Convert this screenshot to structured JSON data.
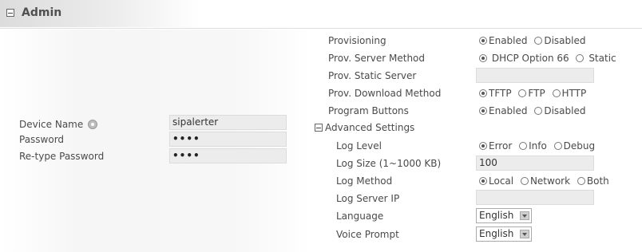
{
  "section": {
    "title": "Admin"
  },
  "left": {
    "device_name_label": "Device Name",
    "device_name_value": "sipalerter",
    "password_label": "Password",
    "password_value": "••••",
    "retype_label": "Re-type Password",
    "retype_value": "••••"
  },
  "right": {
    "provisioning": {
      "label": "Provisioning",
      "options": [
        "Enabled",
        "Disabled"
      ],
      "selected": "Enabled"
    },
    "prov_server_method": {
      "label": "Prov. Server Method",
      "options": [
        "DHCP Option 66",
        "Static"
      ],
      "selected": "DHCP Option 66"
    },
    "prov_static_server": {
      "label": "Prov. Static Server",
      "value": ""
    },
    "prov_download_method": {
      "label": "Prov. Download Method",
      "options": [
        "TFTP",
        "FTP",
        "HTTP"
      ],
      "selected": "TFTP"
    },
    "program_buttons": {
      "label": "Program Buttons",
      "options": [
        "Enabled",
        "Disabled"
      ],
      "selected": "Enabled"
    },
    "advanced_settings": {
      "label": "Advanced Settings"
    },
    "log_level": {
      "label": "Log Level",
      "options": [
        "Error",
        "Info",
        "Debug"
      ],
      "selected": "Error"
    },
    "log_size": {
      "label": "Log Size (1~1000 KB)",
      "value": "100"
    },
    "log_method": {
      "label": "Log Method",
      "options": [
        "Local",
        "Network",
        "Both"
      ],
      "selected": "Local"
    },
    "log_server_ip": {
      "label": "Log Server IP",
      "value": ""
    },
    "language": {
      "label": "Language",
      "value": "English"
    },
    "voice_prompt": {
      "label": "Voice Prompt",
      "value": "English"
    }
  }
}
